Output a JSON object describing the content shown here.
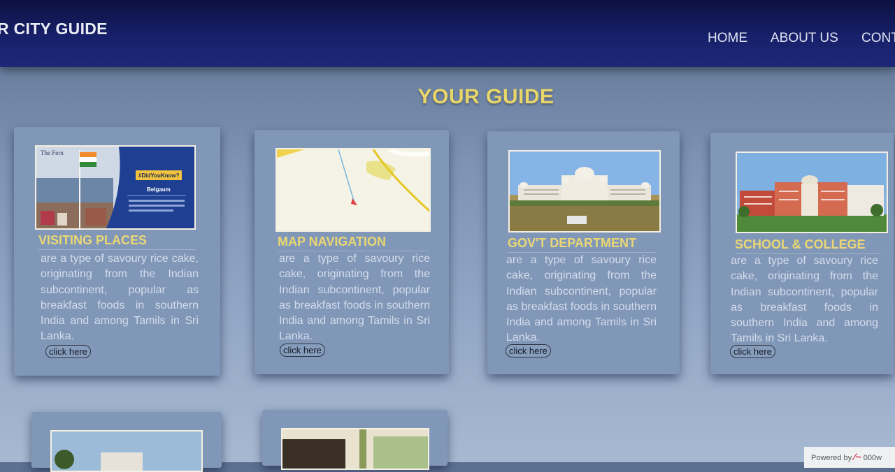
{
  "header": {
    "brand": "R CITY GUIDE",
    "nav": [
      "HOME",
      "ABOUT US",
      "CONT"
    ]
  },
  "main": {
    "title": "YOUR GUIDE",
    "cards": [
      {
        "title": "VISITING PLACES",
        "desc": "are a type of savoury rice cake, originating from the Indian subcontinent, popular as breakfast foods in southern India and among Tamils in Sri Lanka.",
        "button": "click here",
        "image": {
          "logo_text": "The Fern",
          "badge": "#DidYouKnow?",
          "city": "Belgaum"
        }
      },
      {
        "title": "MAP NAVIGATION",
        "desc": "are a type of savoury rice cake, originating from the Indian subcontinent, popular as breakfast foods in southern India and among Tamils in Sri Lanka.",
        "button": "click here"
      },
      {
        "title": "GOV'T DEPARTMENT",
        "desc": "are a type of savoury rice cake, originating from the Indian subcontinent, popular as breakfast foods in southern India and among Tamils in Sri Lanka.",
        "button": "click here"
      },
      {
        "title": "SCHOOL & COLLEGE",
        "desc": "are a type of savoury rice cake, originating from the Indian subcontinent, popular as breakfast foods in southern India and among Tamils in Sri Lanka.",
        "button": "click here"
      }
    ]
  },
  "footer": {
    "powered_label": "Powered by",
    "host": "000w"
  },
  "colors": {
    "navbar": "#17206a",
    "title_gold": "#e8d66a",
    "card_bg": "#8097b8"
  }
}
